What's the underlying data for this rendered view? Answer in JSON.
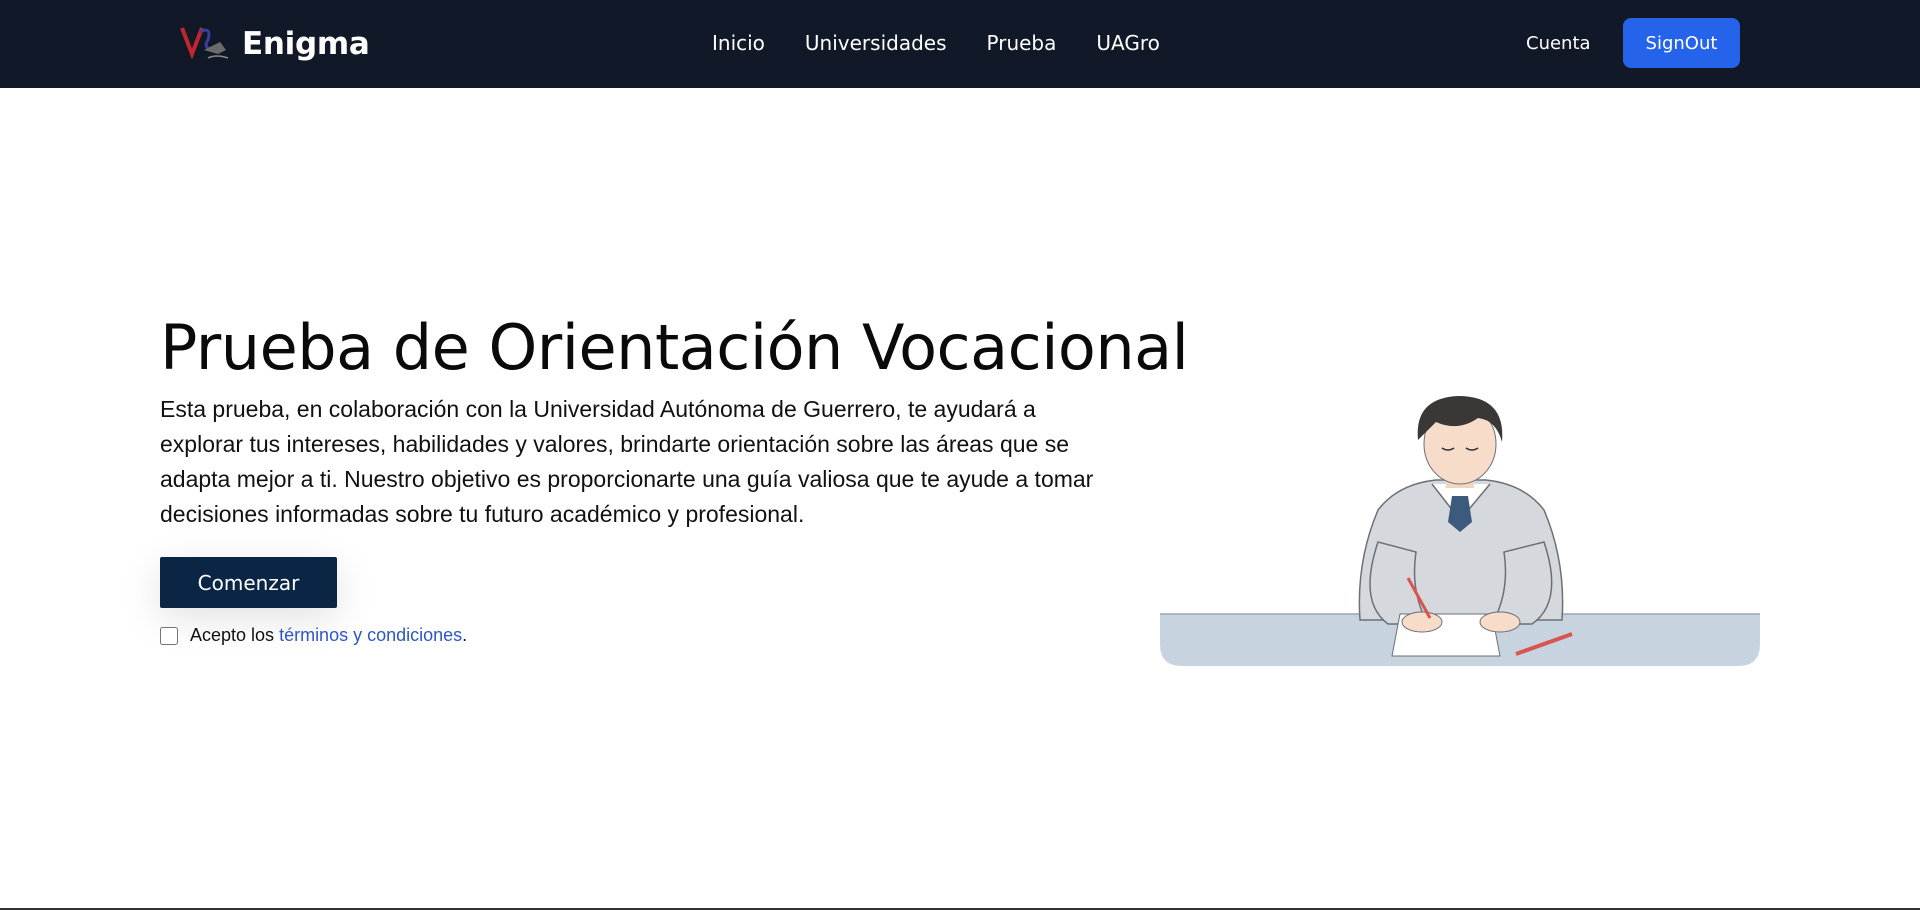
{
  "brand": {
    "name": "Enigma",
    "logo_icon": "enigma-logo-icon"
  },
  "nav": {
    "links": [
      {
        "label": "Inicio"
      },
      {
        "label": "Universidades"
      },
      {
        "label": "Prueba"
      },
      {
        "label": "UAGro"
      }
    ],
    "account_label": "Cuenta",
    "signout_label": "SignOut"
  },
  "hero": {
    "title": "Prueba de Orientación Vocacional",
    "description": "Esta prueba, en colaboración con la Universidad Autónoma de Guerrero, te ayudará a explorar tus intereses, habilidades y valores, brindarte orientación sobre las áreas que se adapta mejor a ti. Nuestro objetivo es proporcionarte una guía valiosa que te ayude a tomar decisiones informadas sobre tu futuro académico y profesional.",
    "start_label": "Comenzar",
    "terms_prefix": "Acepto los ",
    "terms_link": "términos y condiciones",
    "terms_suffix": ".",
    "terms_checked": false
  },
  "colors": {
    "navbar_bg": "#111827",
    "signout_bg": "#2563eb",
    "start_bg": "#0b2545",
    "link": "#2f56c8"
  }
}
